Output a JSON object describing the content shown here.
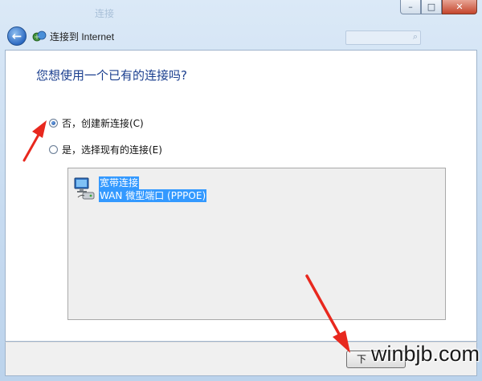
{
  "window": {
    "title_ghost": "连接",
    "minimize_glyph": "–",
    "maximize_glyph": "□",
    "close_glyph": "✕",
    "search_icon_glyph": "⌕"
  },
  "nav": {
    "back_icon": "back-arrow-icon",
    "back_glyph": "←",
    "network_icon": "network-icon",
    "title": "连接到 Internet"
  },
  "page": {
    "heading": "您想使用一个已有的连接吗?",
    "options": [
      {
        "label": "否，创建新连接(C)",
        "checked": true
      },
      {
        "label": "是，选择现有的连接(E)",
        "checked": false
      }
    ],
    "connections": [
      {
        "icon": "broadband-connection-icon",
        "name": "宽带连接",
        "device": "WAN 微型端口 (PPPOE)",
        "selected": true
      }
    ]
  },
  "footer": {
    "next_label": "下"
  },
  "watermark": "winbjb.com",
  "colors": {
    "heading": "#1b3f8f",
    "selection": "#3399ff",
    "annotation_arrow": "#e8281e"
  }
}
